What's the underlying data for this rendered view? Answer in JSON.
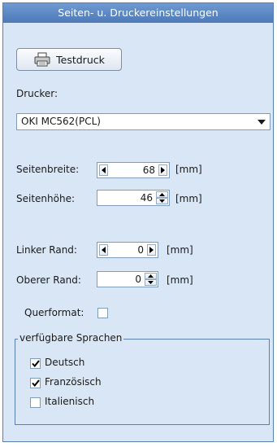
{
  "panel": {
    "title": "Seiten- u. Druckereinstellungen"
  },
  "test_print": {
    "label": "Testdruck"
  },
  "printer": {
    "label": "Drucker:",
    "selected": "OKI MC562(PCL)"
  },
  "page_width": {
    "label": "Seitenbreite:",
    "value": "68",
    "unit": "[mm]"
  },
  "page_height": {
    "label": "Seitenhöhe:",
    "value": "46",
    "unit": "[mm]"
  },
  "left_margin": {
    "label": "Linker Rand:",
    "value": "0",
    "unit": "[mm]"
  },
  "top_margin": {
    "label": "Oberer Rand:",
    "value": "0",
    "unit": "[mm]"
  },
  "landscape": {
    "label": "Querformat:",
    "checked": false
  },
  "languages": {
    "legend": "verfügbare Sprachen",
    "items": [
      {
        "label": "Deutsch",
        "checked": true
      },
      {
        "label": "Französisch",
        "checked": true
      },
      {
        "label": "Italienisch",
        "checked": false
      }
    ]
  }
}
